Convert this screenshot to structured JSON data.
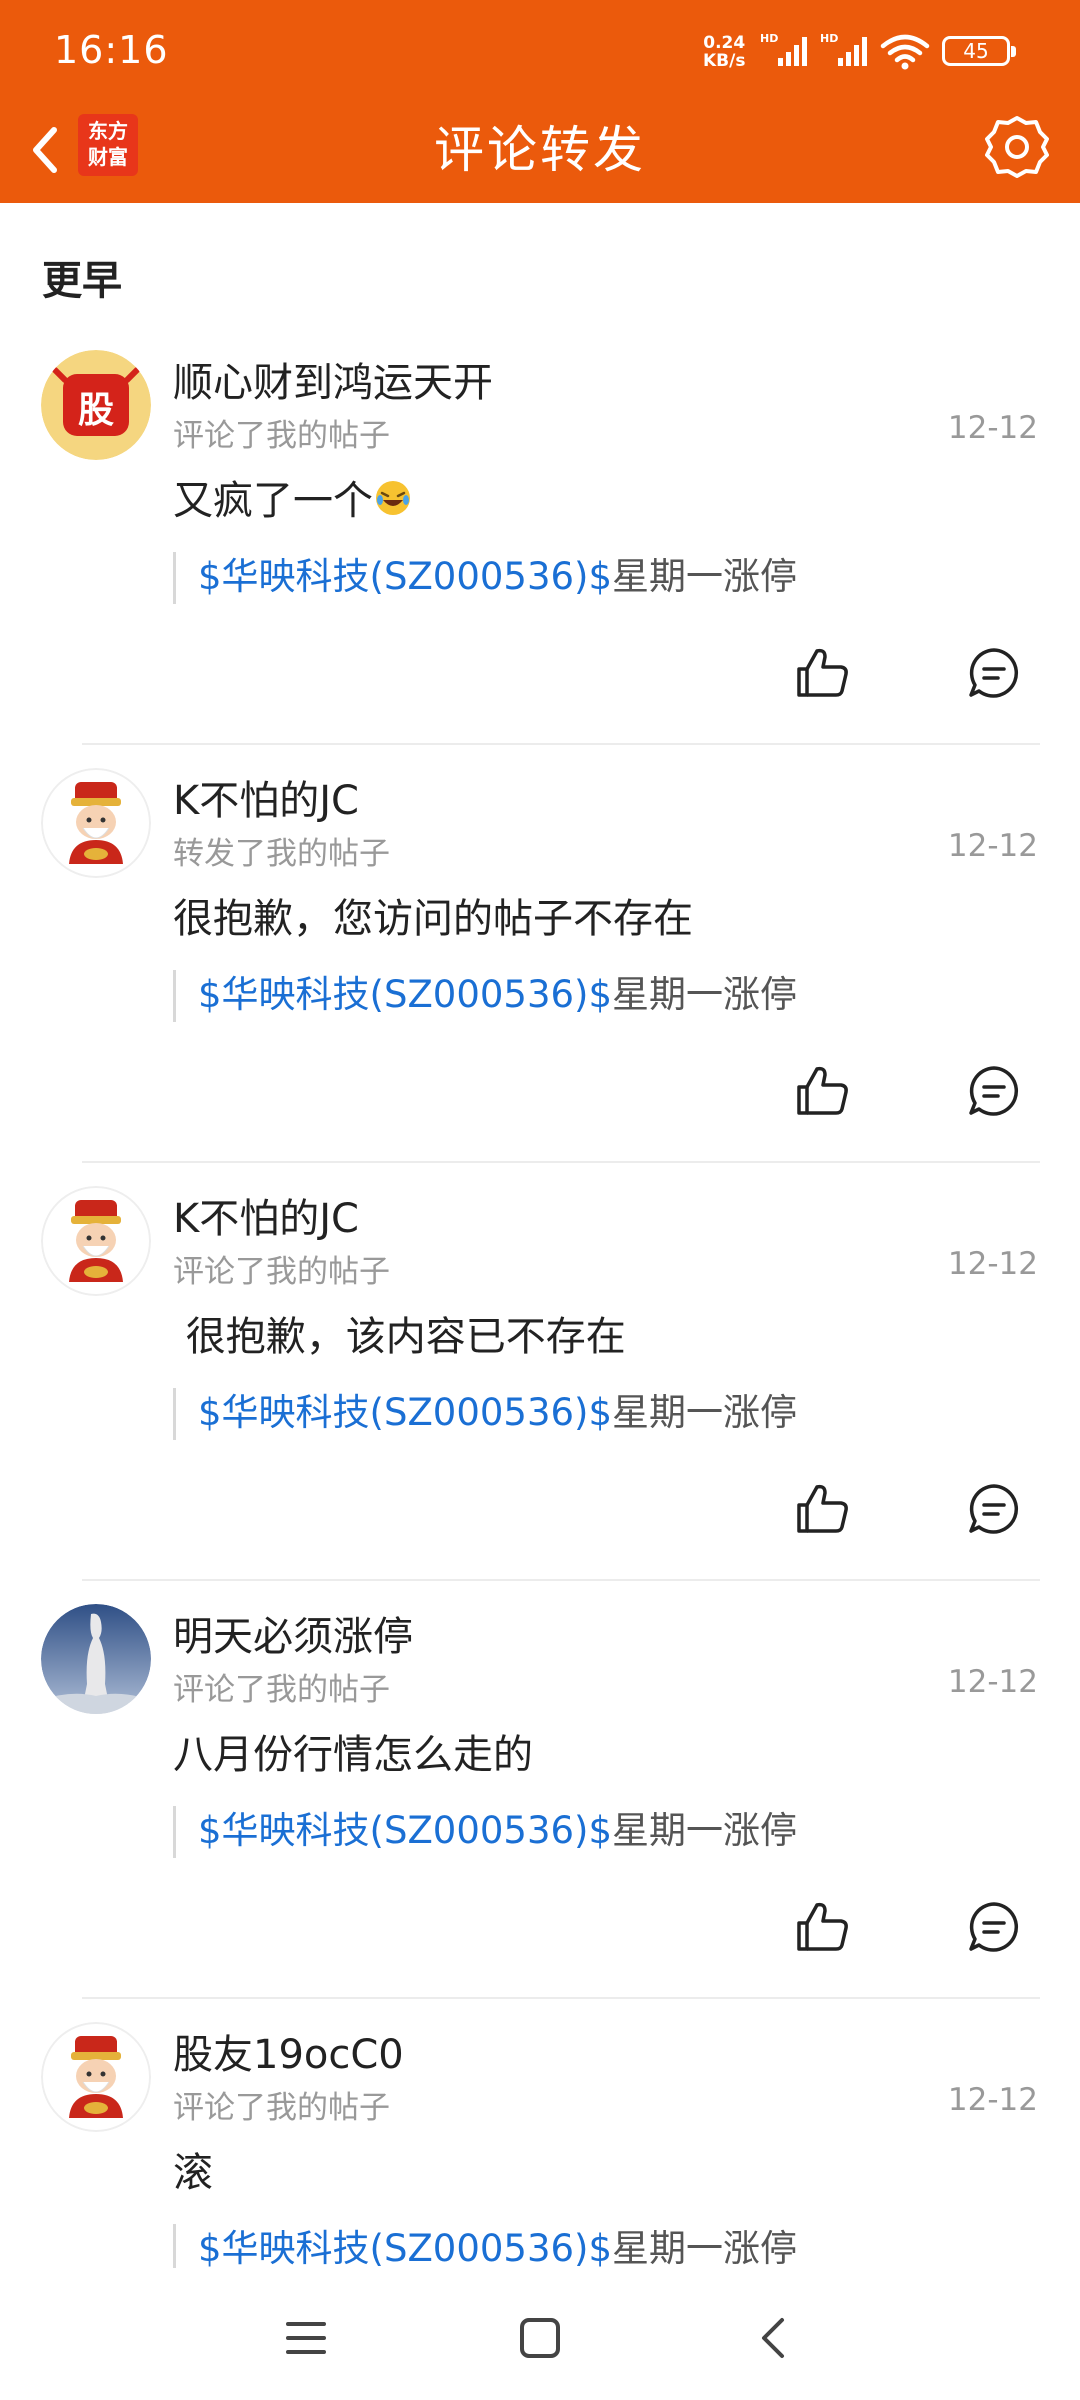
{
  "status_bar": {
    "time": "16:16",
    "net_speed_value": "0.24",
    "net_speed_unit": "KB/s",
    "battery": "45"
  },
  "header": {
    "logo_line1": "东方",
    "logo_line2": "财富",
    "title": "评论转发"
  },
  "section_title": "更早",
  "items": [
    {
      "name": "顺心财到鸿运天开",
      "action": "评论了我的帖子",
      "date": "12-12",
      "content": "又疯了一个",
      "emoji": "🤣",
      "quote_stock": "$华映科技(SZ000536)$",
      "quote_rest": "星期一涨停",
      "avatar": "gu-logo-avatar"
    },
    {
      "name": "K不怕的JC",
      "action": "转发了我的帖子",
      "date": "12-12",
      "content": "很抱歉，您访问的帖子不存在",
      "quote_stock": "$华映科技(SZ000536)$",
      "quote_rest": "星期一涨停",
      "avatar": "caishen-avatar"
    },
    {
      "name": "K不怕的JC",
      "action": "评论了我的帖子",
      "date": "12-12",
      "content": " 很抱歉，该内容已不存在",
      "quote_stock": "$华映科技(SZ000536)$",
      "quote_rest": "星期一涨停",
      "avatar": "caishen-avatar"
    },
    {
      "name": "明天必须涨停",
      "action": "评论了我的帖子",
      "date": "12-12",
      "content": "八月份行情怎么走的",
      "quote_stock": "$华映科技(SZ000536)$",
      "quote_rest": "星期一涨停",
      "avatar": "statue-photo-avatar"
    },
    {
      "name": "股友19ocC0",
      "action": "评论了我的帖子",
      "date": "12-12",
      "content": "滚",
      "quote_stock": "$华映科技(SZ000536)$",
      "quote_rest": "星期一涨停",
      "avatar": "caishen-avatar"
    }
  ],
  "colors": {
    "header_bg": "#eb5a0c",
    "link_blue": "#1a6fd4",
    "meta_gray": "#999999"
  }
}
